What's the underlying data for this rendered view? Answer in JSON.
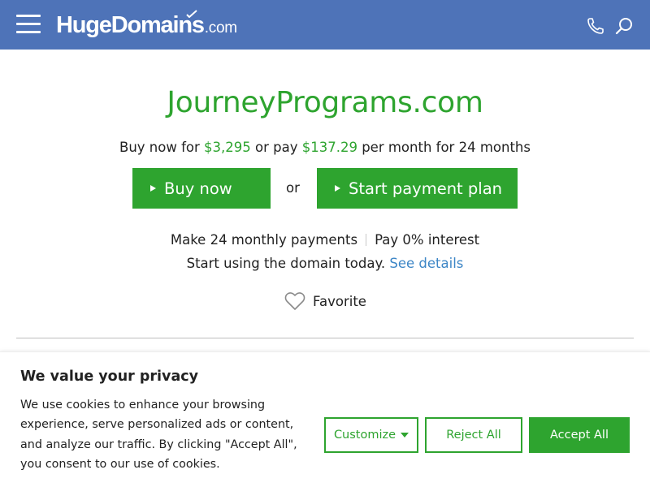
{
  "header": {
    "logo_main": "HugeDomains",
    "logo_suffix": ".com"
  },
  "main": {
    "domain": "JourneyPrograms.com",
    "price": {
      "prefix": "Buy now for ",
      "buy_price": "$3,295",
      "middle": " or pay ",
      "monthly_price": "$137.29",
      "suffix": " per month for 24 months"
    },
    "buy_button": "Buy now",
    "or_text": "or",
    "plan_button": "Start payment plan",
    "payments_left": "Make 24 monthly payments",
    "payments_right": "Pay 0% interest",
    "today_text": "Start using the domain today.",
    "see_details": "See details",
    "favorite": "Favorite"
  },
  "cookie_banner": {
    "title": "We value your privacy",
    "text": "We use cookies to enhance your browsing experience, serve personalized ads or content, and analyze our traffic. By clicking \"Accept All\", you consent to our use of cookies.",
    "customize": "Customize",
    "reject": "Reject All",
    "accept": "Accept All"
  },
  "colors": {
    "header_bg": "#4e73b8",
    "accent_green": "#2ea42f",
    "link_blue": "#3d86c6"
  },
  "icons": [
    "menu-icon",
    "phone-icon",
    "search-icon",
    "play-icon",
    "heart-icon",
    "caret-down-icon"
  ]
}
